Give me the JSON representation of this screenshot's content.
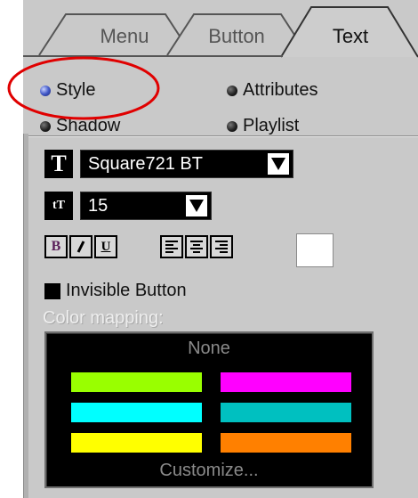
{
  "tabs": [
    {
      "label": "Menu",
      "active": false
    },
    {
      "label": "Button",
      "active": false
    },
    {
      "label": "Text",
      "active": true
    }
  ],
  "radios": {
    "style": {
      "label": "Style",
      "selected": true
    },
    "attributes": {
      "label": "Attributes",
      "selected": false
    },
    "shadow": {
      "label": "Shadow",
      "selected": false
    },
    "playlist": {
      "label": "Playlist",
      "selected": false
    }
  },
  "font": {
    "family_icon": "T",
    "family": "Square721 BT",
    "size_icon": "tT",
    "size": "15"
  },
  "format_buttons": {
    "bold": "B",
    "italic": "I",
    "underline": "U"
  },
  "align_buttons": [
    "align-left",
    "align-center",
    "align-right"
  ],
  "text_color": "#ffffff",
  "invisible_button": {
    "label": "Invisible Button",
    "checked": false
  },
  "color_mapping": {
    "label": "Color mapping:",
    "none_label": "None",
    "customize_label": "Customize...",
    "colors": [
      "#99ff00",
      "#ff00ff",
      "#00ffff",
      "#00c0c0",
      "#ffff00",
      "#ff8000"
    ]
  },
  "annotation_color": "#e00000"
}
